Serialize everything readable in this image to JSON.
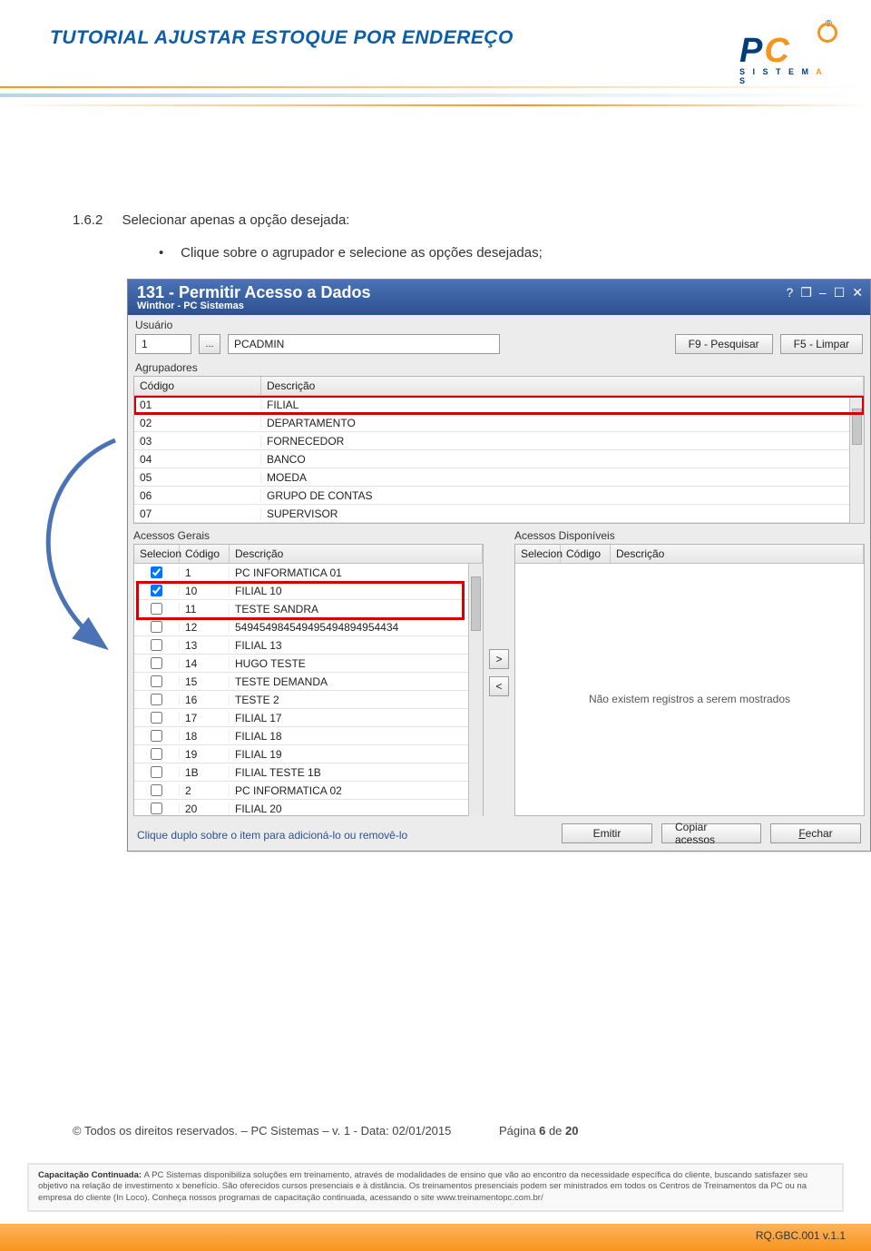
{
  "doc": {
    "title": "TUTORIAL AJUSTAR ESTOQUE POR ENDEREÇO",
    "section_number": "1.6.2",
    "section_text": "Selecionar apenas a opção desejada:",
    "bullet_text": "Clique sobre o agrupador e selecione as opções desejadas;"
  },
  "logo": {
    "p": "P",
    "c": "C",
    "subtitle_pre": "S I S T E M ",
    "subtitle_a": "A",
    "subtitle_post": " S",
    "reg": "®"
  },
  "window": {
    "title": "131 - Permitir Acesso a Dados",
    "subtitle": "Winthor - PC Sistemas",
    "help": "?",
    "userLabel": "Usuário",
    "userCode": "1",
    "userName": "PCADMIN",
    "btnDots": "...",
    "btnSearch": "F9 - Pesquisar",
    "btnClear": "F5 - Limpar",
    "agrupLabel": "Agrupadores",
    "colCod": "Código",
    "colDesc": "Descrição",
    "groups": [
      {
        "cod": "01",
        "desc": "FILIAL"
      },
      {
        "cod": "02",
        "desc": "DEPARTAMENTO"
      },
      {
        "cod": "03",
        "desc": "FORNECEDOR"
      },
      {
        "cod": "04",
        "desc": "BANCO"
      },
      {
        "cod": "05",
        "desc": "MOEDA"
      },
      {
        "cod": "06",
        "desc": "GRUPO DE CONTAS"
      },
      {
        "cod": "07",
        "desc": "SUPERVISOR"
      }
    ],
    "leftPanel": "Acessos Gerais",
    "rightPanel": "Acessos Disponíveis",
    "colSel": "Selecion",
    "moveRight": ">",
    "moveLeft": "<",
    "noRecords": "Não existem registros a serem mostrados",
    "items": [
      {
        "chk": true,
        "cod": "1",
        "desc": "PC INFORMATICA 01"
      },
      {
        "chk": true,
        "cod": "10",
        "desc": "FILIAL 10"
      },
      {
        "chk": false,
        "cod": "11",
        "desc": "TESTE SANDRA"
      },
      {
        "chk": false,
        "cod": "12",
        "desc": "549454984549495494894954434"
      },
      {
        "chk": false,
        "cod": "13",
        "desc": "FILIAL 13"
      },
      {
        "chk": false,
        "cod": "14",
        "desc": "HUGO TESTE"
      },
      {
        "chk": false,
        "cod": "15",
        "desc": "TESTE DEMANDA"
      },
      {
        "chk": false,
        "cod": "16",
        "desc": "TESTE 2"
      },
      {
        "chk": false,
        "cod": "17",
        "desc": "FILIAL 17"
      },
      {
        "chk": false,
        "cod": "18",
        "desc": "FILIAL 18"
      },
      {
        "chk": false,
        "cod": "19",
        "desc": "FILIAL 19"
      },
      {
        "chk": false,
        "cod": "1B",
        "desc": "FILIAL TESTE 1B"
      },
      {
        "chk": false,
        "cod": "2",
        "desc": "PC INFORMATICA 02"
      },
      {
        "chk": false,
        "cod": "20",
        "desc": "FILIAL 20"
      }
    ],
    "hint": "Clique duplo sobre o item para adicioná-lo ou removê-lo",
    "btnEmitir": "Emitir",
    "btnCopiar": "Copiar acessos",
    "btnFechar": "Fechar",
    "fecharUnderline": "F"
  },
  "footer": {
    "copyright": "© Todos os direitos reservados.  – PC Sistemas –  v. 1 - Data: 02/01/2015",
    "page_label": "Página ",
    "page_current": "6",
    "page_of": " de ",
    "page_total": "20",
    "disclaimer_lead": "Capacitação Continuada: ",
    "disclaimer_body": "A PC Sistemas disponibiliza soluções em treinamento, através de modalidades de ensino que vão ao encontro da necessidade específica do cliente, buscando satisfazer seu objetivo na relação de investimento x benefício. São oferecidos cursos presenciais e à distância. Os treinamentos presenciais podem ser ministrados em todos os Centros de Treinamentos da PC ou na empresa do cliente (In Loco). Conheça nossos programas de capacitação continuada, acessando o site www.treinamentopc.com.br/",
    "docid": "RQ.GBC.001 v.1.1"
  }
}
